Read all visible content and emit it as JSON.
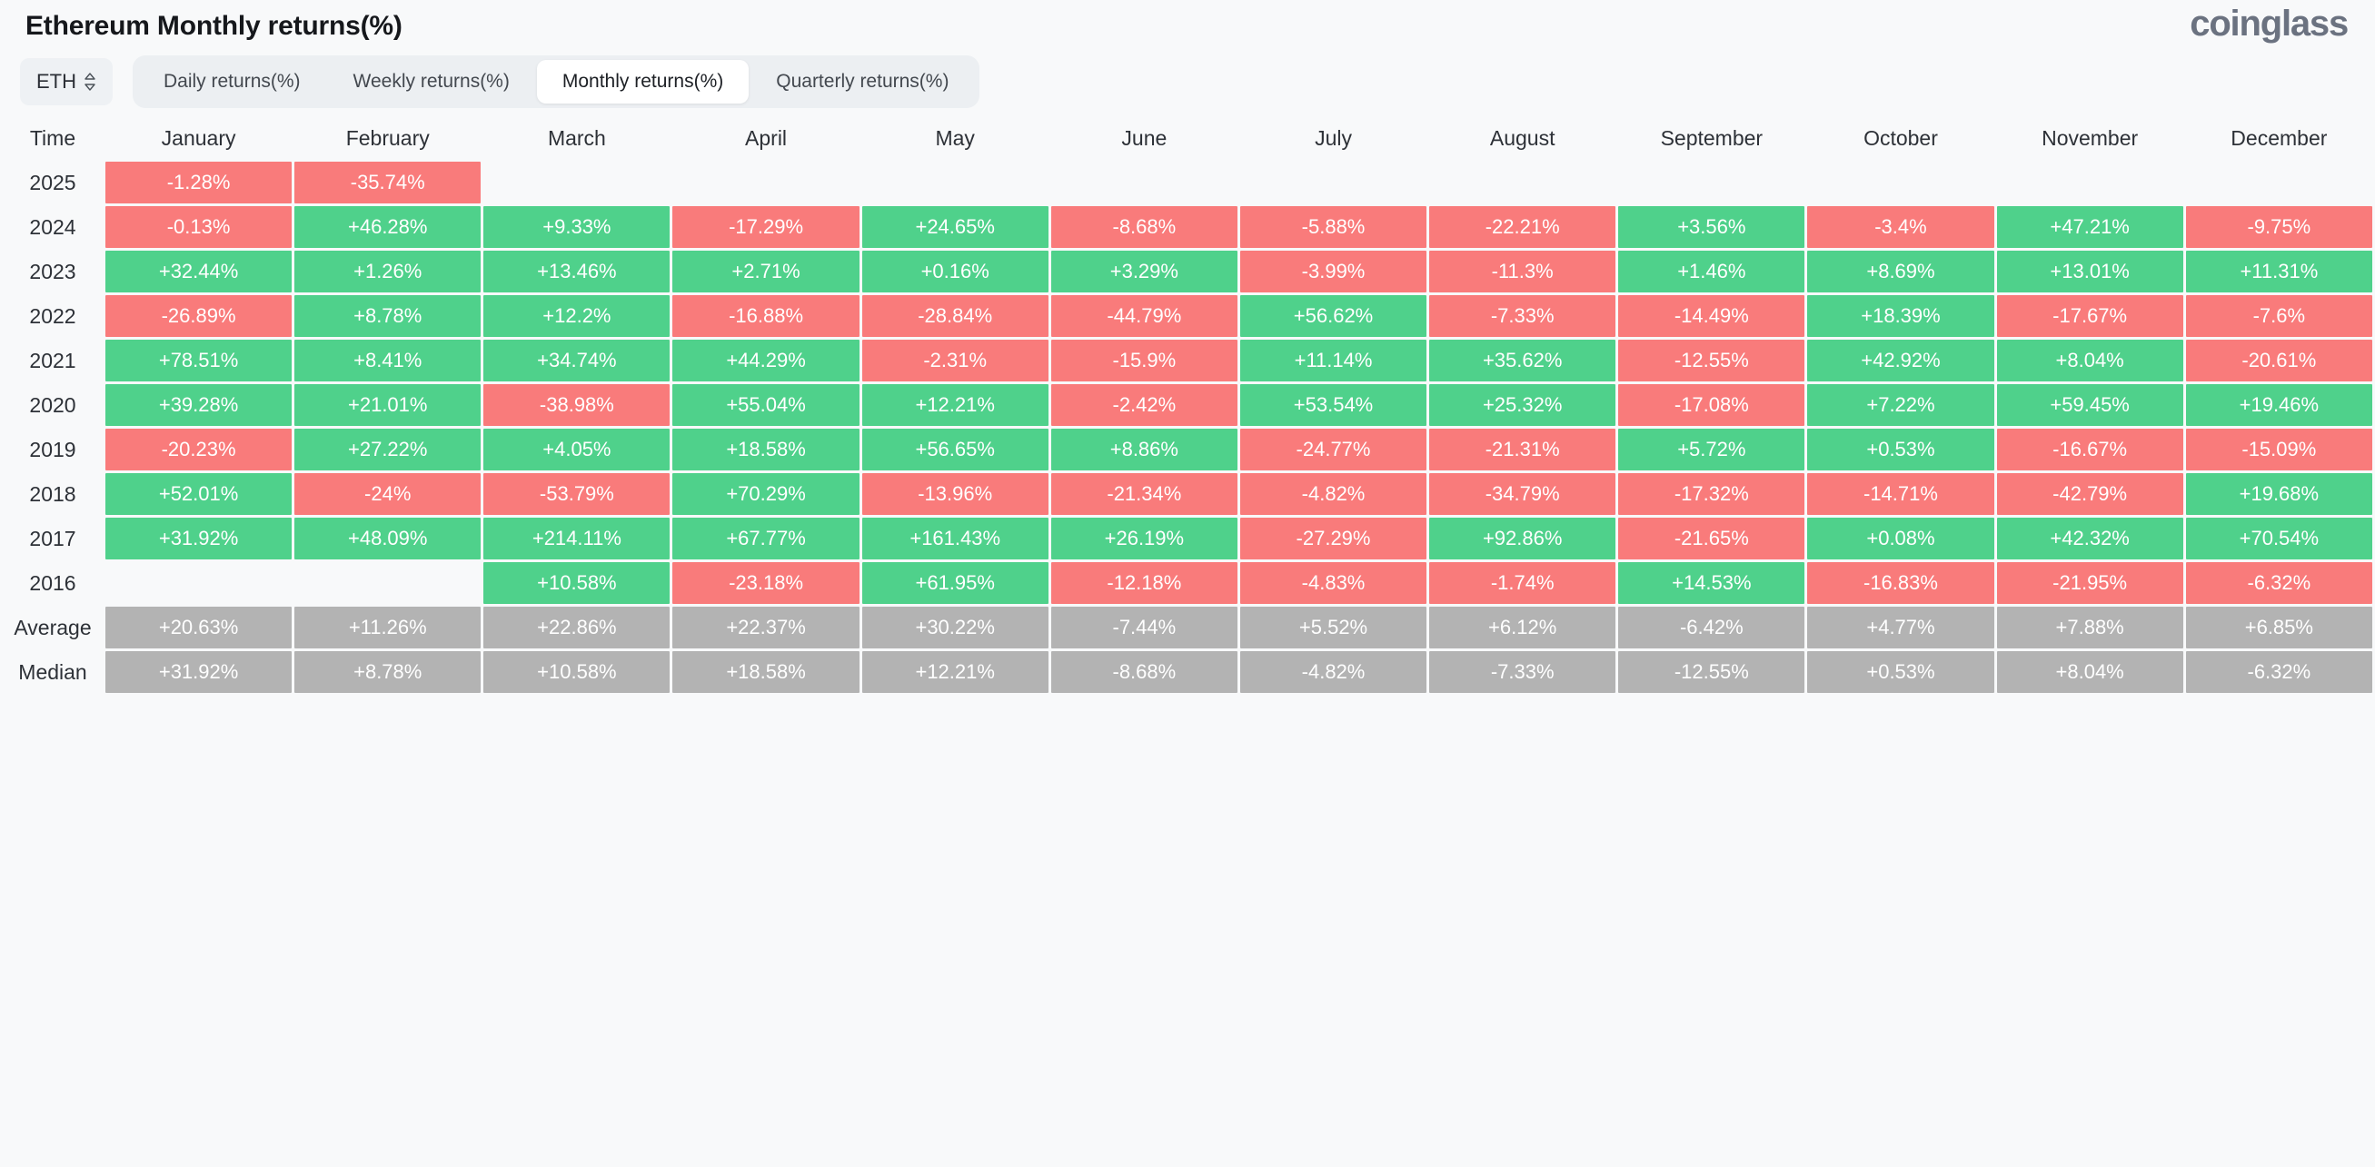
{
  "header": {
    "title": "Ethereum Monthly returns(%)",
    "brand": "coinglass"
  },
  "toolbar": {
    "symbol": "ETH",
    "tabs": [
      {
        "label": "Daily returns(%)",
        "active": false
      },
      {
        "label": "Weekly returns(%)",
        "active": false
      },
      {
        "label": "Monthly returns(%)",
        "active": true
      },
      {
        "label": "Quarterly returns(%)",
        "active": false
      }
    ]
  },
  "colors": {
    "positive": "#4fd18b",
    "negative": "#f97b7b",
    "stat": "#b3b3b3",
    "background": "#f8f9fa",
    "tab_active_bg": "#ffffff",
    "tab_bar_bg": "#eceff2"
  },
  "chart_data": {
    "type": "heatmap",
    "title": "Ethereum Monthly returns(%)",
    "xlabel": "",
    "ylabel": "Time",
    "columns": [
      "Time",
      "January",
      "February",
      "March",
      "April",
      "May",
      "June",
      "July",
      "August",
      "September",
      "October",
      "November",
      "December"
    ],
    "categories": [
      "January",
      "February",
      "March",
      "April",
      "May",
      "June",
      "July",
      "August",
      "September",
      "October",
      "November",
      "December"
    ],
    "rows": [
      {
        "label": "2025",
        "type": "year",
        "values": [
          "-1.28%",
          "-35.74%",
          "",
          "",
          "",
          "",
          "",
          "",
          "",
          "",
          "",
          ""
        ]
      },
      {
        "label": "2024",
        "type": "year",
        "values": [
          "-0.13%",
          "+46.28%",
          "+9.33%",
          "-17.29%",
          "+24.65%",
          "-8.68%",
          "-5.88%",
          "-22.21%",
          "+3.56%",
          "-3.4%",
          "+47.21%",
          "-9.75%"
        ]
      },
      {
        "label": "2023",
        "type": "year",
        "values": [
          "+32.44%",
          "+1.26%",
          "+13.46%",
          "+2.71%",
          "+0.16%",
          "+3.29%",
          "-3.99%",
          "-11.3%",
          "+1.46%",
          "+8.69%",
          "+13.01%",
          "+11.31%"
        ]
      },
      {
        "label": "2022",
        "type": "year",
        "values": [
          "-26.89%",
          "+8.78%",
          "+12.2%",
          "-16.88%",
          "-28.84%",
          "-44.79%",
          "+56.62%",
          "-7.33%",
          "-14.49%",
          "+18.39%",
          "-17.67%",
          "-7.6%"
        ]
      },
      {
        "label": "2021",
        "type": "year",
        "values": [
          "+78.51%",
          "+8.41%",
          "+34.74%",
          "+44.29%",
          "-2.31%",
          "-15.9%",
          "+11.14%",
          "+35.62%",
          "-12.55%",
          "+42.92%",
          "+8.04%",
          "-20.61%"
        ]
      },
      {
        "label": "2020",
        "type": "year",
        "values": [
          "+39.28%",
          "+21.01%",
          "-38.98%",
          "+55.04%",
          "+12.21%",
          "-2.42%",
          "+53.54%",
          "+25.32%",
          "-17.08%",
          "+7.22%",
          "+59.45%",
          "+19.46%"
        ]
      },
      {
        "label": "2019",
        "type": "year",
        "values": [
          "-20.23%",
          "+27.22%",
          "+4.05%",
          "+18.58%",
          "+56.65%",
          "+8.86%",
          "-24.77%",
          "-21.31%",
          "+5.72%",
          "+0.53%",
          "-16.67%",
          "-15.09%"
        ]
      },
      {
        "label": "2018",
        "type": "year",
        "values": [
          "+52.01%",
          "-24%",
          "-53.79%",
          "+70.29%",
          "-13.96%",
          "-21.34%",
          "-4.82%",
          "-34.79%",
          "-17.32%",
          "-14.71%",
          "-42.79%",
          "+19.68%"
        ]
      },
      {
        "label": "2017",
        "type": "year",
        "values": [
          "+31.92%",
          "+48.09%",
          "+214.11%",
          "+67.77%",
          "+161.43%",
          "+26.19%",
          "-27.29%",
          "+92.86%",
          "-21.65%",
          "+0.08%",
          "+42.32%",
          "+70.54%"
        ]
      },
      {
        "label": "2016",
        "type": "year",
        "values": [
          "",
          "",
          "+10.58%",
          "-23.18%",
          "+61.95%",
          "-12.18%",
          "-4.83%",
          "-1.74%",
          "+14.53%",
          "-16.83%",
          "-21.95%",
          "-6.32%"
        ]
      },
      {
        "label": "Average",
        "type": "stat",
        "values": [
          "+20.63%",
          "+11.26%",
          "+22.86%",
          "+22.37%",
          "+30.22%",
          "-7.44%",
          "+5.52%",
          "+6.12%",
          "-6.42%",
          "+4.77%",
          "+7.88%",
          "+6.85%"
        ]
      },
      {
        "label": "Median",
        "type": "stat",
        "values": [
          "+31.92%",
          "+8.78%",
          "+10.58%",
          "+18.58%",
          "+12.21%",
          "-8.68%",
          "-4.82%",
          "-7.33%",
          "-12.55%",
          "+0.53%",
          "+8.04%",
          "-6.32%"
        ]
      }
    ]
  }
}
